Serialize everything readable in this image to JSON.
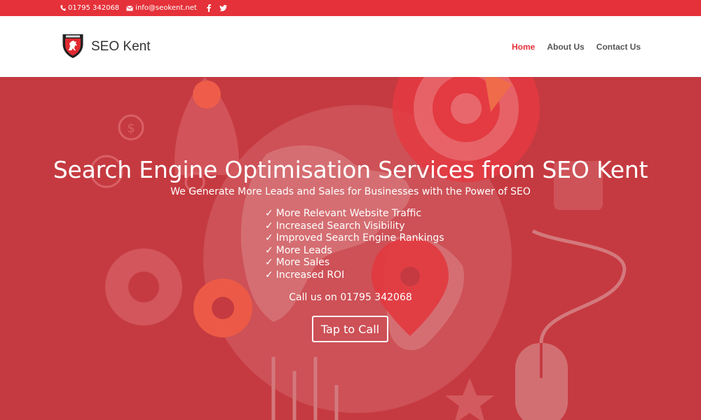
{
  "topbar": {
    "phone": "01795 342068",
    "email": "info@seokent.net",
    "social": [
      "facebook-icon",
      "twitter-icon"
    ]
  },
  "brand": {
    "name": "SEO Kent"
  },
  "nav": {
    "items": [
      {
        "label": "Home",
        "active": true
      },
      {
        "label": "About Us",
        "active": false
      },
      {
        "label": "Contact Us",
        "active": false
      }
    ]
  },
  "hero": {
    "title": "Search Engine Optimisation Services from SEO Kent",
    "subtitle": "We Generate More Leads and Sales for Businesses with the Power of SEO",
    "tick": "✓",
    "bullets": [
      "More Relevant Website Traffic",
      "Increased Search Visibility",
      "Improved Search Engine Rankings",
      "More Leads",
      "More Sales",
      "Increased ROI"
    ],
    "call_text": "Call us on 01795 342068",
    "cta_label": "Tap to Call"
  },
  "colors": {
    "accent": "#e53139",
    "hero_bg": "#c53a40"
  }
}
